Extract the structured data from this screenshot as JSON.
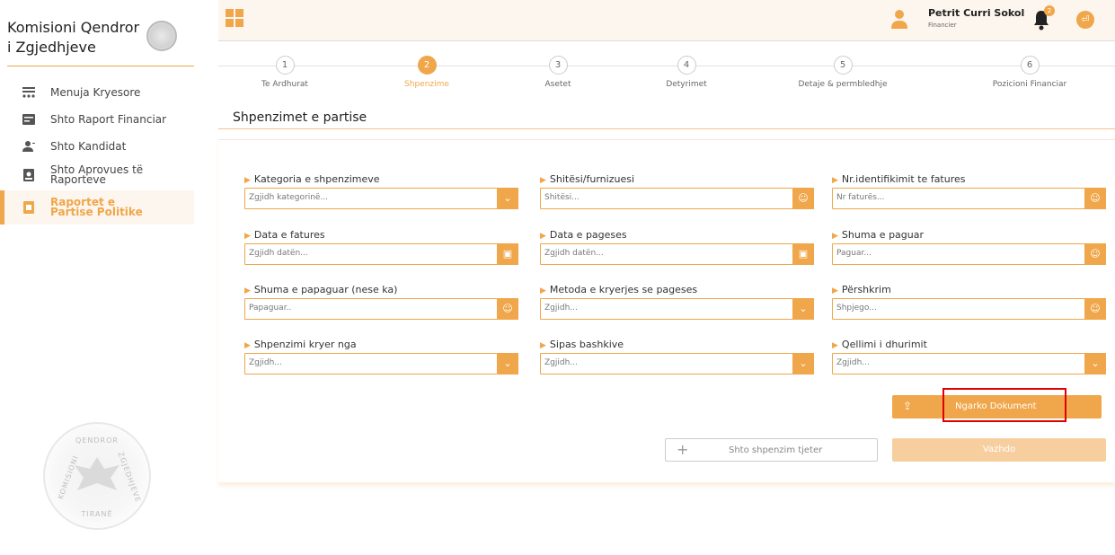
{
  "brand": {
    "title": "Komisioni Qendror i Zgjedhjeve"
  },
  "sidebar": {
    "items": [
      {
        "label": "Menuja Kryesore",
        "icon": "menu-list-icon"
      },
      {
        "label": "Shto Raport Financiar",
        "icon": "report-icon"
      },
      {
        "label": "Shto Kandidat",
        "icon": "add-user-icon"
      },
      {
        "label": "Shto Aprovues të Raporteve",
        "icon": "approver-icon"
      },
      {
        "label": "Raportet e Partise Politike",
        "icon": "party-report-icon"
      }
    ],
    "seal": {
      "top": "QENDROR",
      "left": "KOMISIONI",
      "right": "ZGJEDHJEVE",
      "bottom": "TIRANË"
    }
  },
  "topbar": {
    "user_name": "Petrit Curri Sokol",
    "user_role": "Financier",
    "notifications": "2"
  },
  "stepper": {
    "steps": [
      {
        "num": "1",
        "label": "Te Ardhurat"
      },
      {
        "num": "2",
        "label": "Shpenzime"
      },
      {
        "num": "3",
        "label": "Asetet"
      },
      {
        "num": "4",
        "label": "Detyrimet"
      },
      {
        "num": "5",
        "label": "Detaje & permbledhje"
      },
      {
        "num": "6",
        "label": "Pozicioni Financiar"
      }
    ],
    "active": 2
  },
  "page": {
    "title": "Shpenzimet e partise"
  },
  "form": {
    "fields": [
      {
        "label": "Kategoria e shpenzimeve",
        "placeholder": "Zgjidh kategorinë...",
        "control": "dropdown"
      },
      {
        "label": "Shitësi/furnizuesi",
        "placeholder": "Shitësi...",
        "control": "user"
      },
      {
        "label": "Nr.identifikimit te fatures",
        "placeholder": "Nr faturës...",
        "control": "user"
      },
      {
        "label": "Data e fatures",
        "placeholder": "Zgjidh datën...",
        "control": "calendar"
      },
      {
        "label": "Data e pageses",
        "placeholder": "Zgjidh datën...",
        "control": "calendar"
      },
      {
        "label": "Shuma e paguar",
        "placeholder": "Paguar...",
        "control": "user"
      },
      {
        "label": "Shuma e papaguar (nese ka)",
        "placeholder": "Papaguar..",
        "control": "user"
      },
      {
        "label": "Metoda e kryerjes se pageses",
        "placeholder": "Zgjidh...",
        "control": "dropdown"
      },
      {
        "label": "Përshkrim",
        "placeholder": "Shpjego...",
        "control": "user"
      },
      {
        "label": "Shpenzimi kryer nga",
        "placeholder": "Zgjidh...",
        "control": "dropdown"
      },
      {
        "label": "Sipas bashkive",
        "placeholder": "Zgjidh...",
        "control": "dropdown"
      },
      {
        "label": "Qellimi i dhurimit",
        "placeholder": "Zgjidh...",
        "control": "dropdown"
      }
    ],
    "upload_label": "Ngarko Dokument",
    "add_label": "Shto shpenzim tjeter",
    "next_label": "Vazhdo"
  },
  "colors": {
    "accent": "#f0a64a",
    "highlight": "#e00000"
  }
}
